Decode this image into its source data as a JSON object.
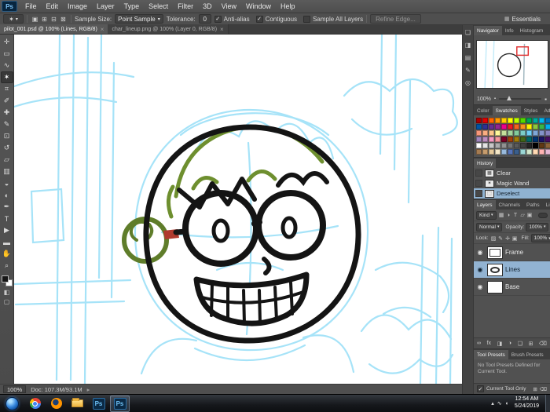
{
  "menu_bar": {
    "logo": "Ps",
    "items": [
      "File",
      "Edit",
      "Image",
      "Layer",
      "Type",
      "Select",
      "Filter",
      "3D",
      "View",
      "Window",
      "Help"
    ]
  },
  "options_bar": {
    "tool_glyph": "✶",
    "selection_modes": [
      {
        "name": "new-selection-icon",
        "glyph": "▣"
      },
      {
        "name": "add-to-selection-icon",
        "glyph": "⊞"
      },
      {
        "name": "subtract-from-selection-icon",
        "glyph": "⊟"
      },
      {
        "name": "intersect-selection-icon",
        "glyph": "⊠"
      }
    ],
    "sample_size_label": "Sample Size:",
    "sample_size_value": "Point Sample",
    "tolerance_label": "Tolerance:",
    "tolerance_value": "0",
    "checks": [
      {
        "label": "Anti-alias",
        "checked": true
      },
      {
        "label": "Contiguous",
        "checked": true
      },
      {
        "label": "Sample All Layers",
        "checked": false
      }
    ],
    "refine_edge_label": "Refine Edge...",
    "workspace_label": "Essentials"
  },
  "doc_tabs": [
    {
      "title": "pilot_001.psd @ 100% (Lines, RGB/8)",
      "active": true
    },
    {
      "title": "char_lineup.png @ 100% (Layer 0, RGB/8)",
      "active": false
    }
  ],
  "toolbar": {
    "tools": [
      {
        "name": "move-tool",
        "glyph": "✛"
      },
      {
        "name": "rectangular-marquee-tool",
        "glyph": "▭"
      },
      {
        "name": "lasso-tool",
        "glyph": "∿"
      },
      {
        "name": "magic-wand-tool",
        "glyph": "✶",
        "selected": true
      },
      {
        "name": "crop-tool",
        "glyph": "⌗"
      },
      {
        "name": "eyedropper-tool",
        "glyph": "✐"
      },
      {
        "name": "healing-brush-tool",
        "glyph": "✚"
      },
      {
        "name": "brush-tool",
        "glyph": "✎"
      },
      {
        "name": "clone-stamp-tool",
        "glyph": "⊡"
      },
      {
        "name": "history-brush-tool",
        "glyph": "↺"
      },
      {
        "name": "eraser-tool",
        "glyph": "▱"
      },
      {
        "name": "gradient-tool",
        "glyph": "▥"
      },
      {
        "name": "blur-tool",
        "glyph": "◒"
      },
      {
        "name": "dodge-tool",
        "glyph": "◐"
      },
      {
        "name": "pen-tool",
        "glyph": "✒"
      },
      {
        "name": "type-tool",
        "glyph": "T"
      },
      {
        "name": "path-selection-tool",
        "glyph": "▶"
      },
      {
        "name": "shape-tool",
        "glyph": "▬"
      },
      {
        "name": "hand-tool",
        "glyph": "✋"
      },
      {
        "name": "zoom-tool",
        "glyph": "⌕"
      }
    ]
  },
  "status_bar": {
    "zoom": "100%",
    "doc_info": "Doc: 107.3M/93.1M"
  },
  "dock_strip": {
    "icons": [
      {
        "name": "collapsed-panel-icon-1",
        "glyph": "❏"
      },
      {
        "name": "collapsed-panel-icon-2",
        "glyph": "◨"
      },
      {
        "name": "collapsed-panel-icon-3",
        "glyph": "▤"
      },
      {
        "name": "collapsed-panel-icon-4",
        "glyph": "✎"
      },
      {
        "name": "collapsed-panel-icon-5",
        "glyph": "◎"
      }
    ]
  },
  "panels": {
    "navigator": {
      "tabs": [
        {
          "label": "Navigator",
          "active": true
        },
        {
          "label": "Info",
          "active": false
        },
        {
          "label": "Histogram",
          "active": false
        }
      ],
      "zoom": "100%"
    },
    "swatches": {
      "tabs": [
        {
          "label": "Color",
          "active": false
        },
        {
          "label": "Swatches",
          "active": true
        },
        {
          "label": "Styles",
          "active": false
        },
        {
          "label": "Adjustments",
          "active": false
        }
      ],
      "colors": [
        "#a80000",
        "#e00000",
        "#ff6600",
        "#ff9900",
        "#ffcc00",
        "#ffff00",
        "#bfff00",
        "#54d900",
        "#00a651",
        "#00a99d",
        "#00b7ef",
        "#0072bc",
        "#0054a6",
        "#2e3192",
        "#662d91",
        "#92278f",
        "#ec008c",
        "#ed1c24",
        "#f26522",
        "#f7941d",
        "#fff200",
        "#8dc73f",
        "#39b54a",
        "#00aeef",
        "#f7977a",
        "#f9ad81",
        "#fdc68a",
        "#fff79a",
        "#c4df9b",
        "#a2d39c",
        "#82ca9d",
        "#7bcdc8",
        "#6ecff6",
        "#7ea7d8",
        "#8493ca",
        "#8882be",
        "#a187be",
        "#bc8dbf",
        "#f49ac2",
        "#f6989d",
        "#7a0026",
        "#a0410d",
        "#9e7c0c",
        "#406618",
        "#006666",
        "#003471",
        "#1b1464",
        "#450e62",
        "#ffffff",
        "#e3e3e3",
        "#c8c8c8",
        "#acacac",
        "#919191",
        "#757575",
        "#5a5a5a",
        "#3e3e3e",
        "#232323",
        "#000000",
        "#603913",
        "#8c6239",
        "#a67c52",
        "#c69c6d",
        "#e6ca9c",
        "#f5e8c9",
        "#99badd",
        "#5674b9",
        "#3a5e8c",
        "#9bd7d5",
        "#d2e7ca",
        "#ffd9b3",
        "#ffb3b3",
        "#e6b8d4"
      ]
    },
    "history": {
      "tabs": [
        {
          "label": "History",
          "active": true
        }
      ],
      "items": [
        {
          "label": "Clear",
          "glyph": "▦",
          "selected": false
        },
        {
          "label": "Magic Wand",
          "glyph": "✶",
          "selected": false
        },
        {
          "label": "Deselect",
          "glyph": "⬚",
          "selected": true
        }
      ]
    },
    "layers": {
      "tabs": [
        {
          "label": "Layers",
          "active": true
        },
        {
          "label": "Channels",
          "active": false
        },
        {
          "label": "Paths",
          "active": false
        },
        {
          "label": "Libraries",
          "active": false
        }
      ],
      "kind_label": "Kind",
      "filter_icons": [
        {
          "name": "filter-pixel-layers-icon",
          "glyph": "▦"
        },
        {
          "name": "filter-adjustment-layers-icon",
          "glyph": "◑"
        },
        {
          "name": "filter-type-layers-icon",
          "glyph": "T"
        },
        {
          "name": "filter-shape-layers-icon",
          "glyph": "▱"
        },
        {
          "name": "filter-smart-objects-icon",
          "glyph": "▣"
        }
      ],
      "blend_mode": "Normal",
      "opacity_label": "Opacity:",
      "opacity_value": "100%",
      "lock_label": "Lock:",
      "lock_icons": [
        {
          "name": "lock-transparency-icon",
          "glyph": "▨"
        },
        {
          "name": "lock-pixels-icon",
          "glyph": "✎"
        },
        {
          "name": "lock-position-icon",
          "glyph": "✛"
        },
        {
          "name": "lock-all-icon",
          "glyph": "▣"
        }
      ],
      "fill_label": "Fill:",
      "fill_value": "100%",
      "rows": [
        {
          "name": "Frame",
          "selected": false
        },
        {
          "name": "Lines",
          "selected": true
        },
        {
          "name": "Base",
          "selected": false
        }
      ],
      "footer_icons": [
        {
          "name": "link-layers-icon",
          "glyph": "∞"
        },
        {
          "name": "layer-style-icon",
          "glyph": "fx"
        },
        {
          "name": "layer-mask-icon",
          "glyph": "◨"
        },
        {
          "name": "adjustment-layer-icon",
          "glyph": "◑"
        },
        {
          "name": "new-group-icon",
          "glyph": "❏"
        },
        {
          "name": "new-layer-icon",
          "glyph": "⊞"
        },
        {
          "name": "delete-layer-icon",
          "glyph": "⌫"
        }
      ]
    },
    "tool_presets": {
      "tabs": [
        {
          "label": "Tool Presets",
          "active": true
        },
        {
          "label": "Brush Presets",
          "active": false
        }
      ],
      "empty_message": "No Tool Presets Defined for Current Tool.",
      "current_tool_only_label": "Current Tool Only",
      "current_tool_only_checked": true
    }
  },
  "taskbar": {
    "clock_time": "12:54 AM",
    "clock_date": "5/24/2019"
  }
}
